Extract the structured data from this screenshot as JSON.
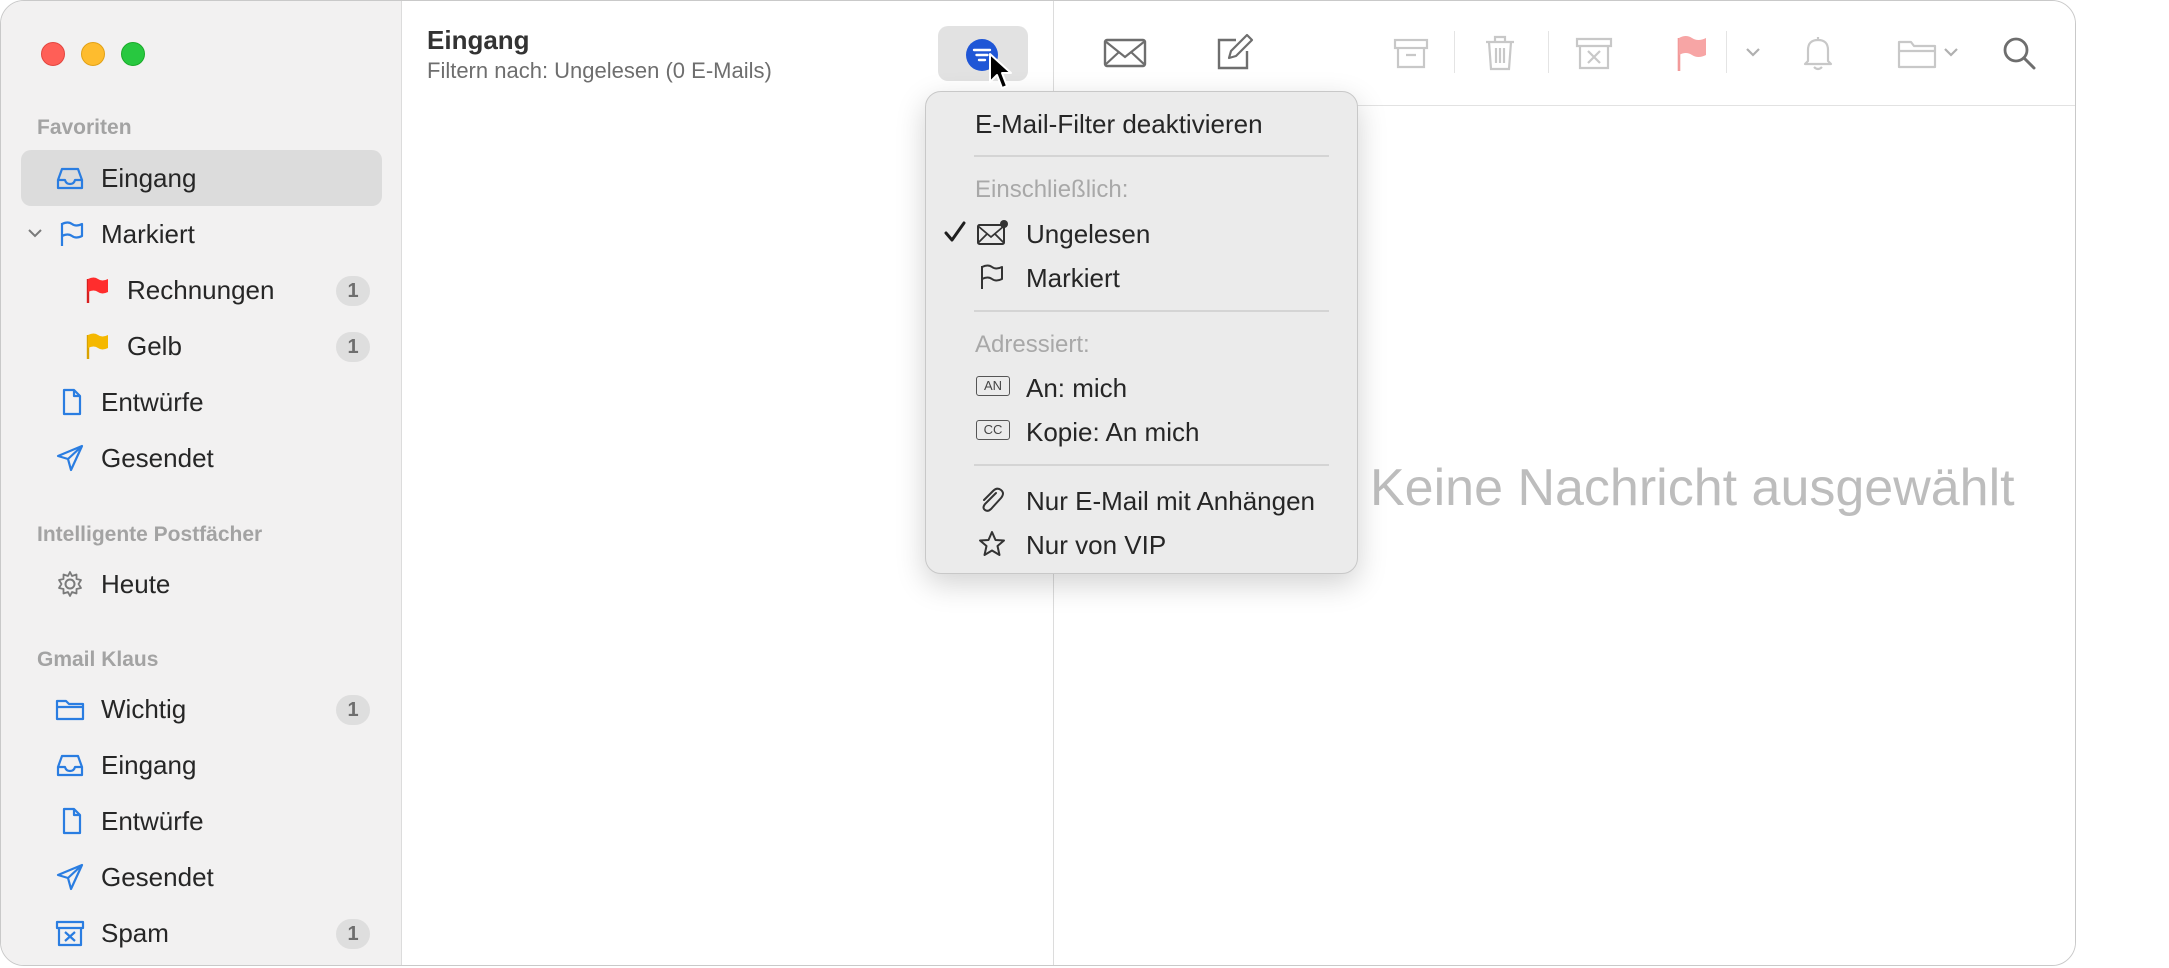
{
  "sidebar": {
    "favorites_title": "Favoriten",
    "favorites": [
      {
        "label": "Eingang",
        "icon": "inbox-icon",
        "selected": true
      },
      {
        "label": "Markiert",
        "icon": "flag-outline-icon"
      },
      {
        "label": "Rechnungen",
        "icon": "red-flag-icon",
        "count": "1"
      },
      {
        "label": "Gelb",
        "icon": "yellow-flag-icon",
        "count": "1"
      },
      {
        "label": "Entwürfe",
        "icon": "document-icon"
      },
      {
        "label": "Gesendet",
        "icon": "paper-plane-icon"
      }
    ],
    "smart_title": "Intelligente Postfächer",
    "smart": [
      {
        "label": "Heute",
        "icon": "gear-icon"
      }
    ],
    "account_title": "Gmail Klaus",
    "account": [
      {
        "label": "Wichtig",
        "icon": "folder-icon",
        "count": "1"
      },
      {
        "label": "Eingang",
        "icon": "inbox-icon"
      },
      {
        "label": "Entwürfe",
        "icon": "document-icon"
      },
      {
        "label": "Gesendet",
        "icon": "paper-plane-icon"
      },
      {
        "label": "Spam",
        "icon": "junk-icon",
        "count": "1"
      }
    ]
  },
  "list": {
    "title": "Eingang",
    "subtitle": "Filtern nach: Ungelesen (0 E-Mails)"
  },
  "detail": {
    "empty_message": "Keine Nachricht ausgewählt"
  },
  "menu": {
    "disable_filter": "E-Mail-Filter deaktivieren",
    "including_header": "Einschließlich:",
    "unread": "Ungelesen",
    "flagged": "Markiert",
    "addressed_header": "Adressiert:",
    "to_me": "An: mich",
    "to_me_badge": "AN",
    "cc_me": "Kopie: An mich",
    "cc_me_badge": "CC",
    "attachments_only": "Nur E-Mail mit Anhängen",
    "vip_only": "Nur von VIP"
  },
  "colors": {
    "accent": "#1f56d6",
    "flag_red": "#ff2d2d",
    "flag_yellow": "#f5b800",
    "icon_blue": "#2a7de1"
  }
}
